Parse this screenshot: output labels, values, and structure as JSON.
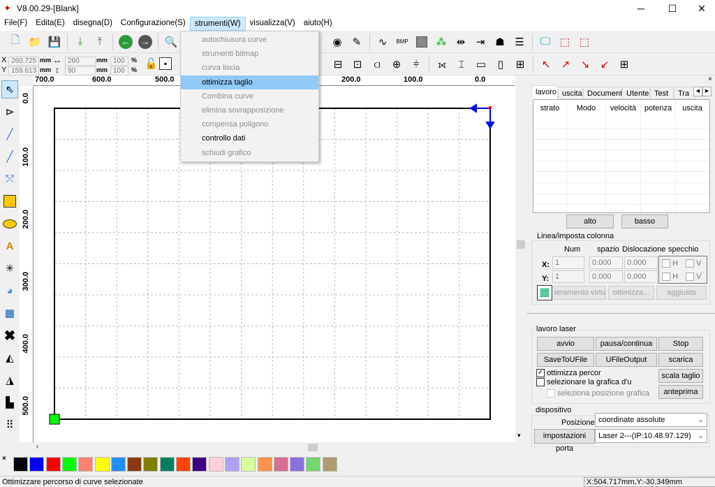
{
  "window": {
    "title": "V8.00.29-[Blank]",
    "minimize": "─",
    "maximize": "☐",
    "close": "✕"
  },
  "menubar": [
    "File(F)",
    "Edita(E)",
    "disegna(D)",
    "Configurazione(S)",
    "strumenti(W)",
    "visualizza(V)",
    "aiuto(H)"
  ],
  "open_menu": {
    "items": [
      {
        "label": "autochiusura curve",
        "enabled": false
      },
      {
        "label": "strumenti bitmap",
        "enabled": false
      },
      {
        "label": "curva liscia",
        "enabled": false
      },
      {
        "label": "ottimizza taglio",
        "enabled": true,
        "highlighted": true
      },
      {
        "label": "Combina curve",
        "enabled": false
      },
      {
        "label": "elimina sovrapposizione",
        "enabled": false
      },
      {
        "label": "compensa poligono",
        "enabled": false
      },
      {
        "label": "controllo dati",
        "enabled": true
      },
      {
        "label": "schiudi grafico",
        "enabled": false
      }
    ]
  },
  "toolbar2": {
    "x_label": "X",
    "y_label": "Y",
    "x": "260.725",
    "y": "159.613",
    "unit": "mm",
    "width": "260",
    "height": "90",
    "scale_x": "100",
    "scale_y": "100",
    "pct": "%"
  },
  "ruler": {
    "top": [
      "700.0",
      "600.0",
      "500.0",
      "200.0",
      "100.0",
      "0.0"
    ],
    "left": [
      "0.0",
      "100.0",
      "200.0",
      "300.0",
      "400.0",
      "500.0"
    ]
  },
  "panel": {
    "tabs": [
      "lavoro",
      "uscita",
      "Documenti",
      "Utente",
      "Test",
      "Tra"
    ],
    "columns": [
      "strato",
      "Modo",
      "velocità",
      "potenza",
      "uscita"
    ],
    "up": "alto",
    "down": "basso",
    "array": {
      "title": "Linea/imposta colonna",
      "headers": [
        "Num",
        "spazio",
        "Dislocazione",
        "specchio"
      ],
      "x_label": "X:",
      "y_label": "Y:",
      "x_num": "1",
      "x_space": "0.000",
      "x_disl": "0.000",
      "y_num": "1",
      "y_space": "0.000",
      "y_disl": "0.000",
      "h": "H",
      "v": "V",
      "virtual": "ieramento virtu",
      "optimize": "ottimizza...",
      "adjust": "aggiusta"
    },
    "laser": {
      "title": "lavoro laser",
      "start": "avvio",
      "pause": "pausa/continua",
      "stop": "Stop",
      "save": "SaveToUFile",
      "ufile": "UFileOutput",
      "download": "scarica",
      "opt_path": "ottimizza percor",
      "opt_path_checked": true,
      "select_graphic": "selezionare la grafica d'u",
      "select_pos": "seleziona posizione grafica",
      "scale": "scala taglio",
      "preview": "anteprima"
    },
    "device": {
      "title": "dispositivo",
      "pos_label": "Posizione:",
      "pos_value": "coordinate assolute",
      "port": "impostazioni porta",
      "laser": "Laser 2---(IP:10.48.97.129)"
    }
  },
  "palette": [
    "#000000",
    "#0000ff",
    "#ff0000",
    "#00ff00",
    "#ff8070",
    "#ffff00",
    "#1e90ff",
    "#8b3a10",
    "#808000",
    "#008060",
    "#ff4500",
    "#400080",
    "#ffd0d8",
    "#b0a0f8",
    "#d8ff98",
    "#ff9050",
    "#d87090",
    "#8870e0",
    "#70d870",
    "#b09c70"
  ],
  "status": {
    "message": "Ottimizzare percorso di curve selezionate",
    "coords": "X:504.717mm,Y:-30.349mm"
  },
  "colors": {
    "accent": "#91c9f7",
    "start_marker": "#00ff00",
    "origin_arrow": "#0000ff"
  }
}
